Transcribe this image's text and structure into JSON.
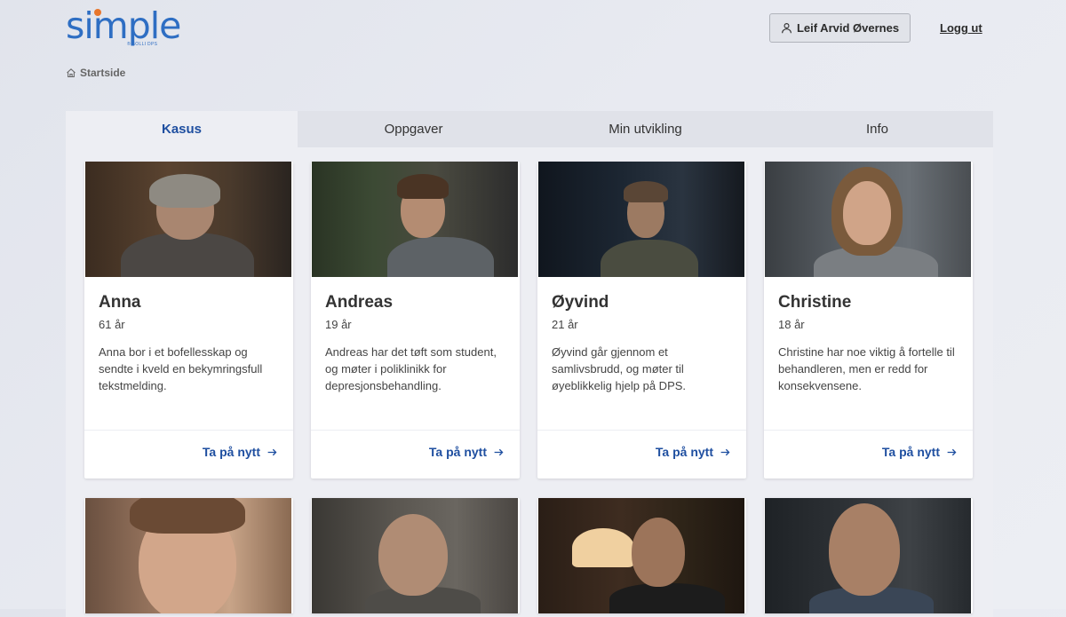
{
  "logo": {
    "text": "simple",
    "subtext": "® SOLLI DPS"
  },
  "header": {
    "user_name": "Leif Arvid Øvernes",
    "logout_label": "Logg ut"
  },
  "breadcrumb": {
    "home_label": "Startside"
  },
  "tabs": [
    {
      "label": "Kasus",
      "active": true
    },
    {
      "label": "Oppgaver",
      "active": false
    },
    {
      "label": "Min utvikling",
      "active": false
    },
    {
      "label": "Info",
      "active": false
    }
  ],
  "cards": [
    {
      "name": "Anna",
      "age": "61 år",
      "description": "Anna bor i et bofellesskap og sendte i kveld en bekymringsfull tekstmelding.",
      "action": "Ta på nytt"
    },
    {
      "name": "Andreas",
      "age": "19 år",
      "description": "Andreas har det tøft som student, og møter i poliklinikk for depresjonsbehandling.",
      "action": "Ta på nytt"
    },
    {
      "name": "Øyvind",
      "age": "21 år",
      "description": "Øyvind går gjennom et samlivsbrudd, og møter til øyeblikkelig hjelp på DPS.",
      "action": "Ta på nytt"
    },
    {
      "name": "Christine",
      "age": "18 år",
      "description": "Christine har noe viktig å fortelle til behandleren, men er redd for konsekvensene.",
      "action": "Ta på nytt"
    }
  ],
  "colors": {
    "accent": "#1f4fa0",
    "logo": "#2e6ec3",
    "logo_dot": "#e8762c"
  },
  "icons": {
    "user": "user-icon",
    "home": "home-icon",
    "arrow": "arrow-right-icon"
  }
}
